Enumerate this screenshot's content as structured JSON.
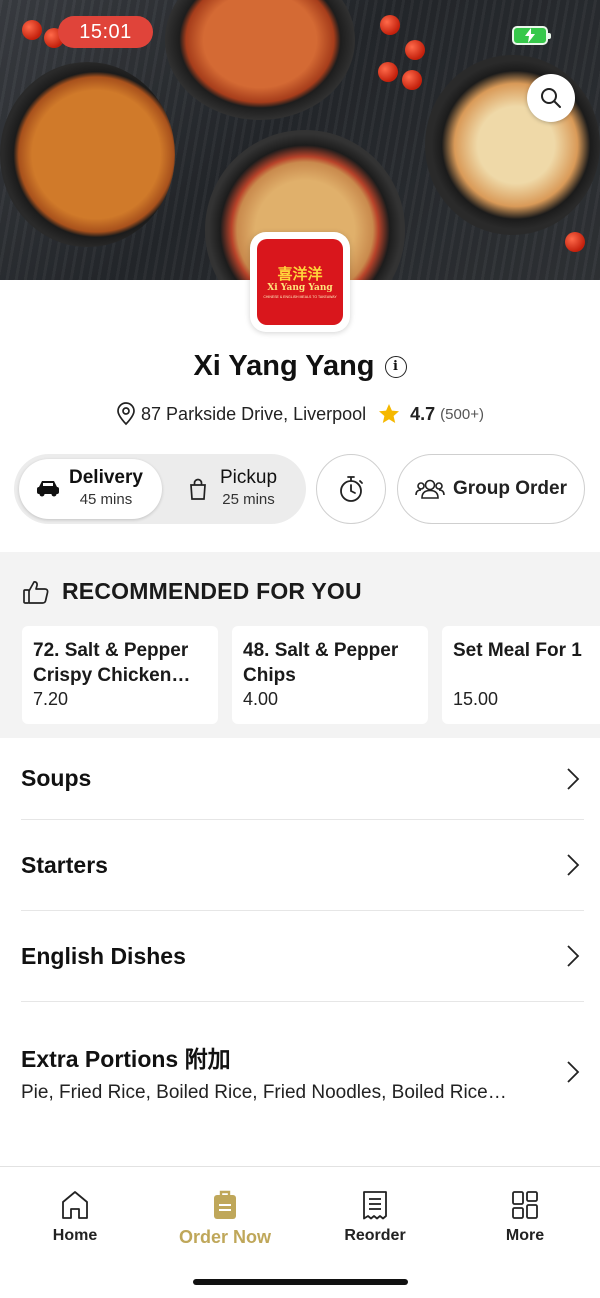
{
  "status_bar": {
    "time": "15:01"
  },
  "restaurant": {
    "logo": {
      "chinese": "喜洋洋",
      "english": "Xi Yang Yang",
      "tagline": "CHINESE & ENGLISH MEALS TO TAKEAWAY"
    },
    "name": "Xi Yang Yang",
    "address": "87 Parkside Drive, Liverpool",
    "rating": "4.7",
    "reviews": "(500+)"
  },
  "order_mode": {
    "delivery": {
      "label": "Delivery",
      "time": "45 mins",
      "selected": true
    },
    "pickup": {
      "label": "Pickup",
      "time": "25 mins",
      "selected": false
    },
    "group_order_label": "Group Order"
  },
  "recommended": {
    "heading": "RECOMMENDED FOR YOU",
    "items": [
      {
        "line1": "72. Salt & Pepper",
        "line2": "Crispy Chicken…",
        "price": "7.20"
      },
      {
        "line1": "48. Salt & Pepper",
        "line2": "Chips",
        "price": "4.00"
      },
      {
        "line1": "Set Meal For 1",
        "line2": "",
        "price": "15.00"
      }
    ]
  },
  "categories": [
    {
      "title": "Soups"
    },
    {
      "title": "Starters"
    },
    {
      "title": "English Dishes"
    },
    {
      "title": "Extra Portions 附加",
      "description": "Pie, Fried Rice, Boiled Rice, Fried Noodles, Boiled Rice…"
    }
  ],
  "bottom_nav": [
    {
      "label": "Home",
      "icon": "home-icon"
    },
    {
      "label": "Order Now",
      "icon": "order-bag-icon",
      "active": true
    },
    {
      "label": "Reorder",
      "icon": "receipt-icon"
    },
    {
      "label": "More",
      "icon": "grid-icon"
    }
  ],
  "colors": {
    "accent": "#bfa75a",
    "time_pill": "#e0443a",
    "logo_red": "#d9161c",
    "star": "#f5b800",
    "battery": "#36c84a"
  }
}
